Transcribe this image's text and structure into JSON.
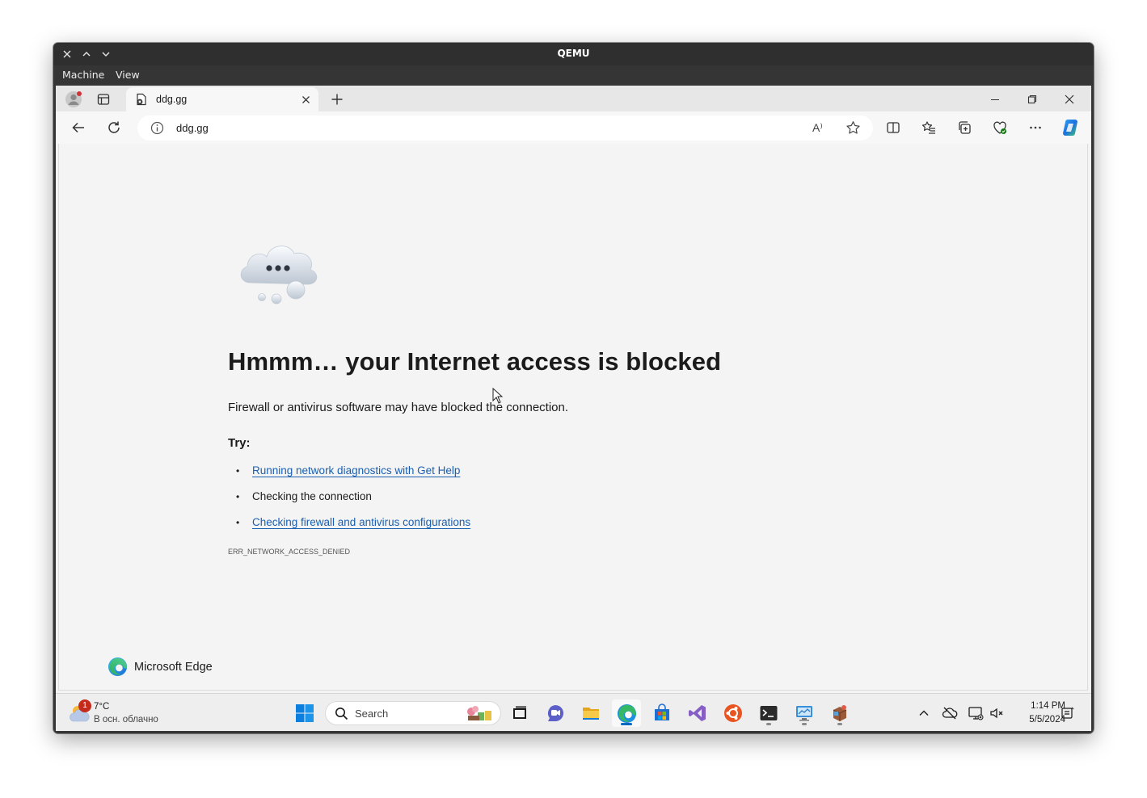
{
  "qemu": {
    "title": "QEMU",
    "menus": [
      "Machine",
      "View"
    ]
  },
  "browser": {
    "tab_title": "ddg.gg",
    "address": "ddg.gg",
    "read_aloud_label": "A⁾"
  },
  "error_page": {
    "heading": "Hmmm… your Internet access is blocked",
    "subtitle": "Firewall or antivirus software may have blocked the connection.",
    "try_label": "Try:",
    "suggestions": [
      {
        "text": "Running network diagnostics with Get Help",
        "is_link": true
      },
      {
        "text": "Checking the connection",
        "is_link": false
      },
      {
        "text": "Checking firewall and antivirus configurations",
        "is_link": true
      }
    ],
    "error_code": "ERR_NETWORK_ACCESS_DENIED",
    "brand": "Microsoft Edge"
  },
  "taskbar": {
    "weather_temp": "7°C",
    "weather_desc": "В осн. облачно",
    "weather_badge": "1",
    "search_placeholder": "Search",
    "time": "1:14 PM",
    "date": "5/5/2024"
  },
  "colors": {
    "link": "#1a5fb0",
    "accent": "#0067c0",
    "qemu_chrome": "#353535"
  }
}
